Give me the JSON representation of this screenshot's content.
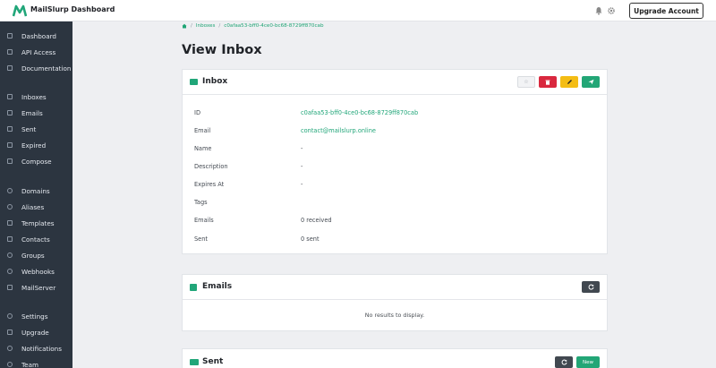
{
  "app": {
    "brand": "MailSlurp Dashboard",
    "upgrade_label": "Upgrade Account"
  },
  "sidebar": {
    "items": [
      {
        "label": "Dashboard",
        "icon": "dashboard-icon"
      },
      {
        "label": "API Access",
        "icon": "code-icon"
      },
      {
        "label": "Documentation",
        "icon": "book-icon"
      },
      {
        "label": "Inboxes",
        "icon": "inbox-icon"
      },
      {
        "label": "Emails",
        "icon": "mail-icon"
      },
      {
        "label": "Sent",
        "icon": "send-icon"
      },
      {
        "label": "Expired",
        "icon": "archive-icon"
      },
      {
        "label": "Compose",
        "icon": "compose-icon"
      },
      {
        "label": "Domains",
        "icon": "globe-icon"
      },
      {
        "label": "Aliases",
        "icon": "at-icon"
      },
      {
        "label": "Templates",
        "icon": "template-icon"
      },
      {
        "label": "Contacts",
        "icon": "contacts-icon"
      },
      {
        "label": "Groups",
        "icon": "groups-icon"
      },
      {
        "label": "Webhooks",
        "icon": "webhook-icon"
      },
      {
        "label": "MailServer",
        "icon": "server-icon"
      },
      {
        "label": "Settings",
        "icon": "gear-icon"
      },
      {
        "label": "Upgrade",
        "icon": "upgrade-icon"
      },
      {
        "label": "Notifications",
        "icon": "bell-icon"
      },
      {
        "label": "Team",
        "icon": "team-icon"
      }
    ]
  },
  "breadcrumb": {
    "section": "Inboxes",
    "current": "c0afaa53-bff0-4ce0-bc68-8729ff870cab"
  },
  "page": {
    "title": "View Inbox"
  },
  "inbox_card": {
    "title": "Inbox",
    "fields": [
      {
        "label": "ID",
        "value": "c0afaa53-bff0-4ce0-bc68-8729ff870cab"
      },
      {
        "label": "Email",
        "value": "contact@mailslurp.online"
      },
      {
        "label": "Name",
        "value": "-"
      },
      {
        "label": "Description",
        "value": "-"
      },
      {
        "label": "Expires At",
        "value": "-"
      },
      {
        "label": "Tags",
        "value": ""
      },
      {
        "label": "Emails",
        "value": "0 received"
      },
      {
        "label": "Sent",
        "value": "0 sent"
      }
    ]
  },
  "emails_card": {
    "title": "Emails",
    "empty_text": "No results to display."
  },
  "sent_card": {
    "title": "Sent",
    "new_label": "New"
  },
  "colors": {
    "accent": "#21a679",
    "sidebar": "#2c3540",
    "danger": "#d9283e",
    "warning": "#f4bd14"
  }
}
